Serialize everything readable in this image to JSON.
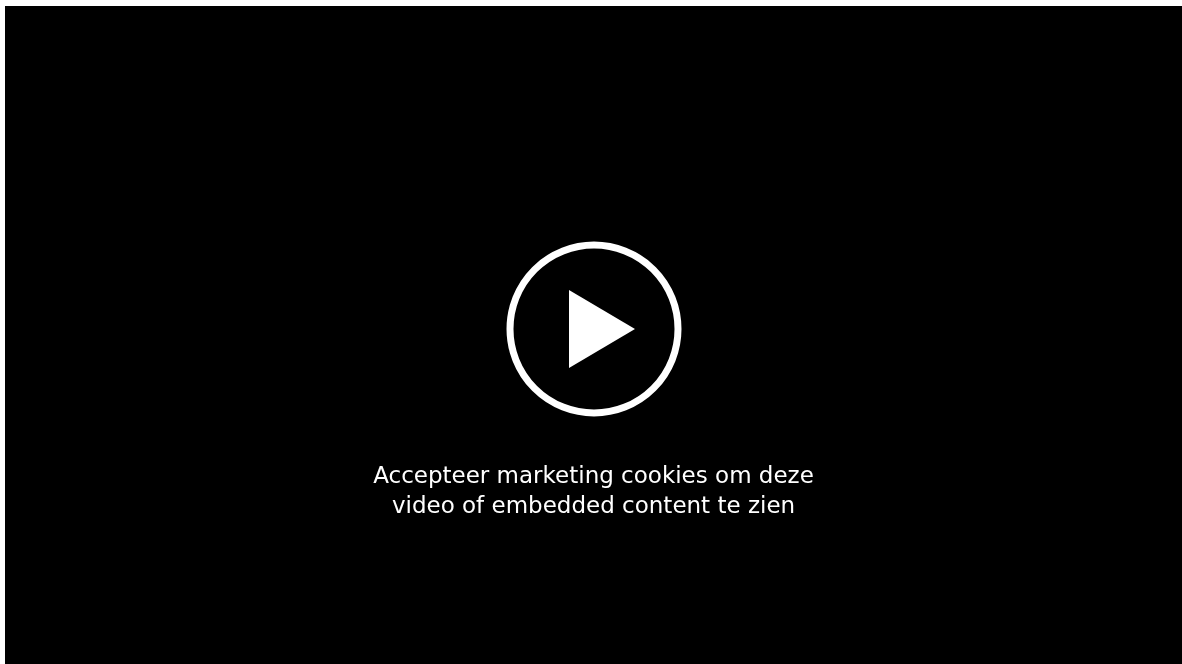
{
  "video_placeholder": {
    "message": "Accepteer marketing cookies om deze video of embedded content te zien"
  }
}
